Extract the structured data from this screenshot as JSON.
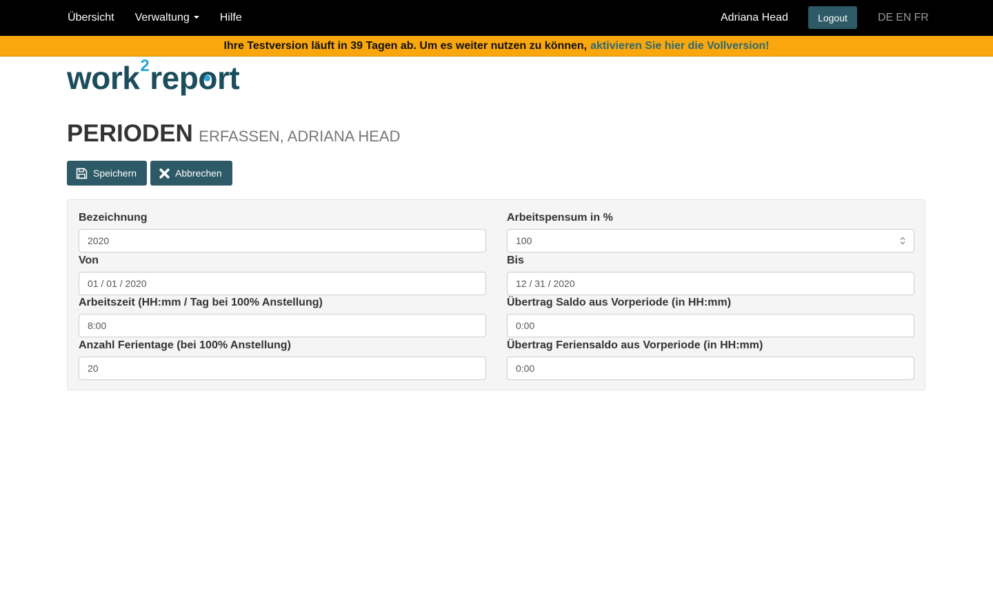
{
  "nav": {
    "items": [
      "Übersicht",
      "Verwaltung",
      "Hilfe"
    ],
    "user": "Adriana Head",
    "logout": "Logout",
    "languages": [
      "DE",
      "EN",
      "FR"
    ]
  },
  "banner": {
    "text": "Ihre Testversion läuft in 39 Tagen ab. Um es weiter nutzen zu können,",
    "link": "aktivieren Sie hier die Vollversion!"
  },
  "logo": {
    "part1": "work",
    "sup": "2",
    "part2": "rep",
    "o": "o",
    "part3": "rt"
  },
  "heading": {
    "main": "PERIODEN",
    "sub": "ERFASSEN, ADRIANA HEAD"
  },
  "actions": {
    "save": "Speichern",
    "cancel": "Abbrechen"
  },
  "form": {
    "bezeichnung": {
      "label": "Bezeichnung",
      "value": "2020"
    },
    "pensum": {
      "label": "Arbeitspensum in %",
      "value": "100"
    },
    "von": {
      "label": "Von",
      "value": " 01 / 01 / 2020"
    },
    "bis": {
      "label": "Bis",
      "value": " 12 / 31 / 2020"
    },
    "arbeitszeit": {
      "label": "Arbeitszeit (HH:mm / Tag bei 100% Anstellung)",
      "value": "8:00"
    },
    "saldo": {
      "label": "Übertrag Saldo aus Vorperiode (in HH:mm)",
      "value": "0:00"
    },
    "ferientage": {
      "label": "Anzahl Ferientage (bei 100% Anstellung)",
      "value": "20"
    },
    "feriensaldo": {
      "label": "Übertrag Feriensaldo aus Vorperiode (in HH:mm)",
      "value": "0:00"
    }
  },
  "colors": {
    "navbar": "#000000",
    "banner": "#f9a70c",
    "primary": "#2d5a66",
    "logo": "#1b4d5c",
    "logo_accent": "#2aa3d6"
  }
}
